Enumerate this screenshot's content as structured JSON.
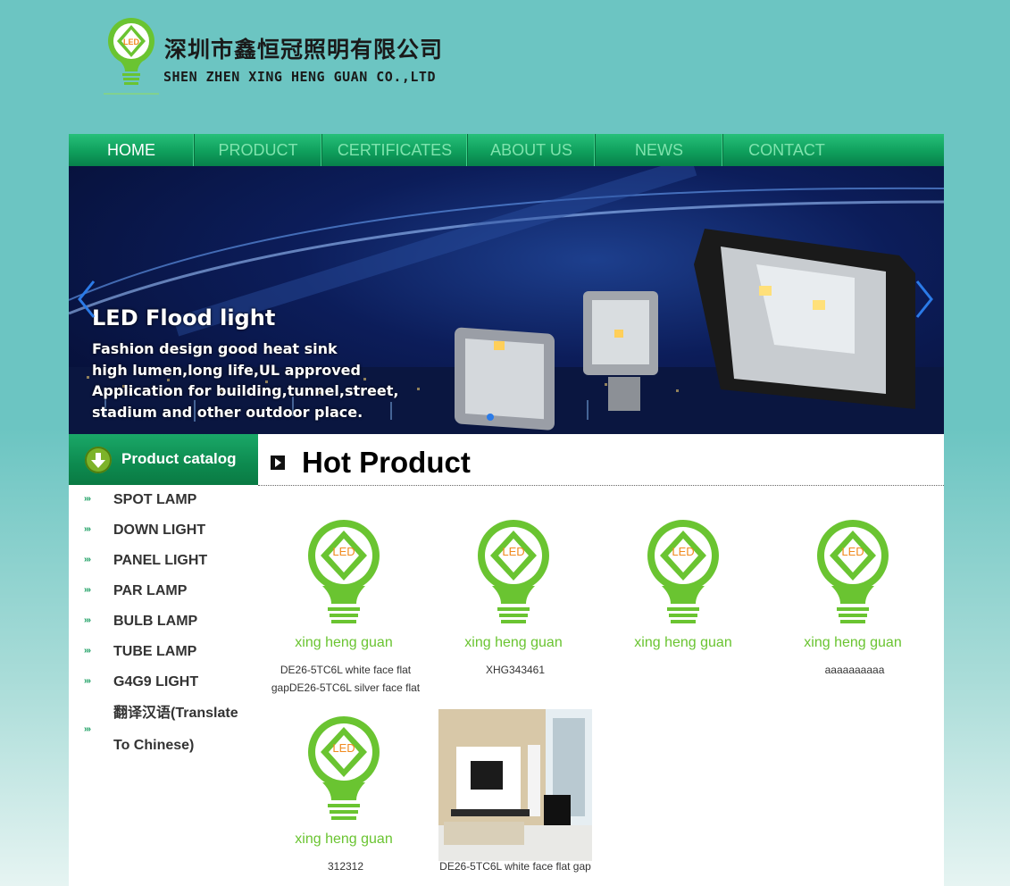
{
  "header": {
    "company_cn": "深圳市鑫恒冠照明有限公司",
    "company_en": "SHEN ZHEN XING HENG GUAN CO.,LTD",
    "logo_text": "LED"
  },
  "nav": {
    "items": [
      {
        "label": "HOME",
        "active": true
      },
      {
        "label": "PRODUCT",
        "active": false
      },
      {
        "label": "CERTIFICATES",
        "active": false
      },
      {
        "label": "ABOUT US",
        "active": false
      },
      {
        "label": "NEWS",
        "active": false
      },
      {
        "label": "CONTACT",
        "active": false
      }
    ]
  },
  "banner": {
    "title": "LED Flood light",
    "lines": [
      "Fashion design good heat sink",
      "high lumen,long life,UL approved",
      "Application for building,tunnel,street,",
      "stadium and other outdoor place."
    ],
    "prev_icon": "chevron-left-icon",
    "next_icon": "chevron-right-icon"
  },
  "catalog": {
    "title": "Product catalog",
    "bullet": "›››",
    "items": [
      {
        "label": "SPOT LAMP"
      },
      {
        "label": "DOWN LIGHT"
      },
      {
        "label": "PANEL LIGHT"
      },
      {
        "label": "PAR LAMP"
      },
      {
        "label": "BULB LAMP"
      },
      {
        "label": "TUBE LAMP"
      },
      {
        "label": "G4G9 LIGHT"
      },
      {
        "label": "翻译汉语(Translate To Chinese)"
      }
    ]
  },
  "hot": {
    "title": "Hot Product",
    "placeholder_logo_led": "LED",
    "placeholder_logo_text": "xing heng guan",
    "products": [
      {
        "name": "DE26-5TC6L white face flat gapDE26-5TC6L silver face flat"
      },
      {
        "name": "XHG343461"
      },
      {
        "name": ""
      },
      {
        "name": "aaaaaaaaaa"
      },
      {
        "name": "312312"
      },
      {
        "name": "DE26-5TC6L white face flat gap"
      }
    ]
  },
  "colors": {
    "page_bg": "#6cc5c2",
    "nav_green": "#0f9f5c",
    "nav_text": "#7fe3ad",
    "logo_green": "#6ac431",
    "logo_orange": "#f08a1f"
  }
}
